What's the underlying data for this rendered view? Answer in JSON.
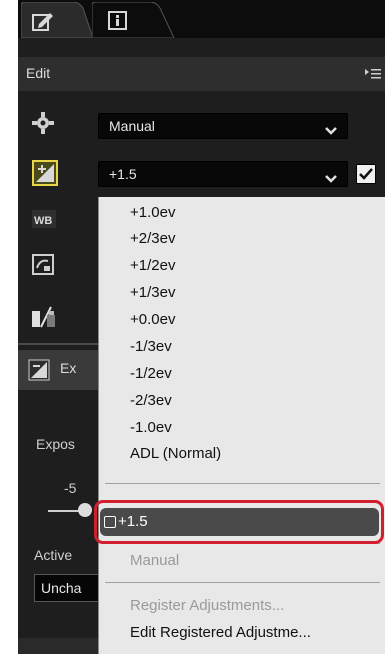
{
  "tabs": [
    {
      "name": "edit",
      "icon": "edit-pencil-icon"
    },
    {
      "name": "info",
      "icon": "info-icon"
    }
  ],
  "header": {
    "title": "Edit",
    "menu_icon": "panel-menu-icon"
  },
  "picture_control_dropdown": {
    "value": "Manual",
    "icon": "gear-icon"
  },
  "exposure_dropdown": {
    "value": "+1.5",
    "icon": "exposure-compensation-icon",
    "checked": true
  },
  "side_icons": [
    "wb-icon",
    "picture-control-icon",
    "tone-icon"
  ],
  "exposure_section": {
    "header_prefix": "Ex",
    "label_prefix": "Expos",
    "slider_value": "-5",
    "active_label": "Active",
    "active_value": "Uncha"
  },
  "popup_menu": {
    "options": [
      "+1.0ev",
      "+2/3ev",
      "+1/2ev",
      "+1/3ev",
      "+0.0ev",
      "-1/3ev",
      "-1/2ev",
      "-2/3ev",
      "-1.0ev",
      "ADL (Normal)"
    ],
    "selected": "+1.5",
    "manual": "Manual",
    "register": "Register Adjustments...",
    "edit_registered": "Edit Registered Adjustme..."
  },
  "colors": {
    "highlight_border": "#d21e2e",
    "panel_bg": "#1e1e1e",
    "menu_bg": "#e8e8e8"
  }
}
